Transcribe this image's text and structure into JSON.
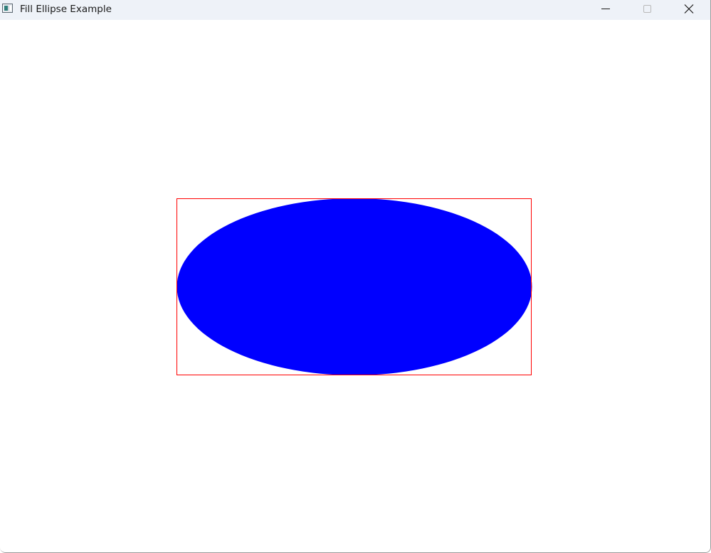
{
  "window": {
    "title": "Fill Ellipse Example",
    "icon": "window-app-icon"
  },
  "caption_buttons": {
    "minimize_icon": "minimize-icon",
    "maximize_icon": "maximize-icon",
    "close_icon": "close-icon"
  },
  "drawing": {
    "ellipse_fill_color": "#0000ff",
    "bounding_rect_color": "#ff0000",
    "background_color": "#ffffff"
  }
}
